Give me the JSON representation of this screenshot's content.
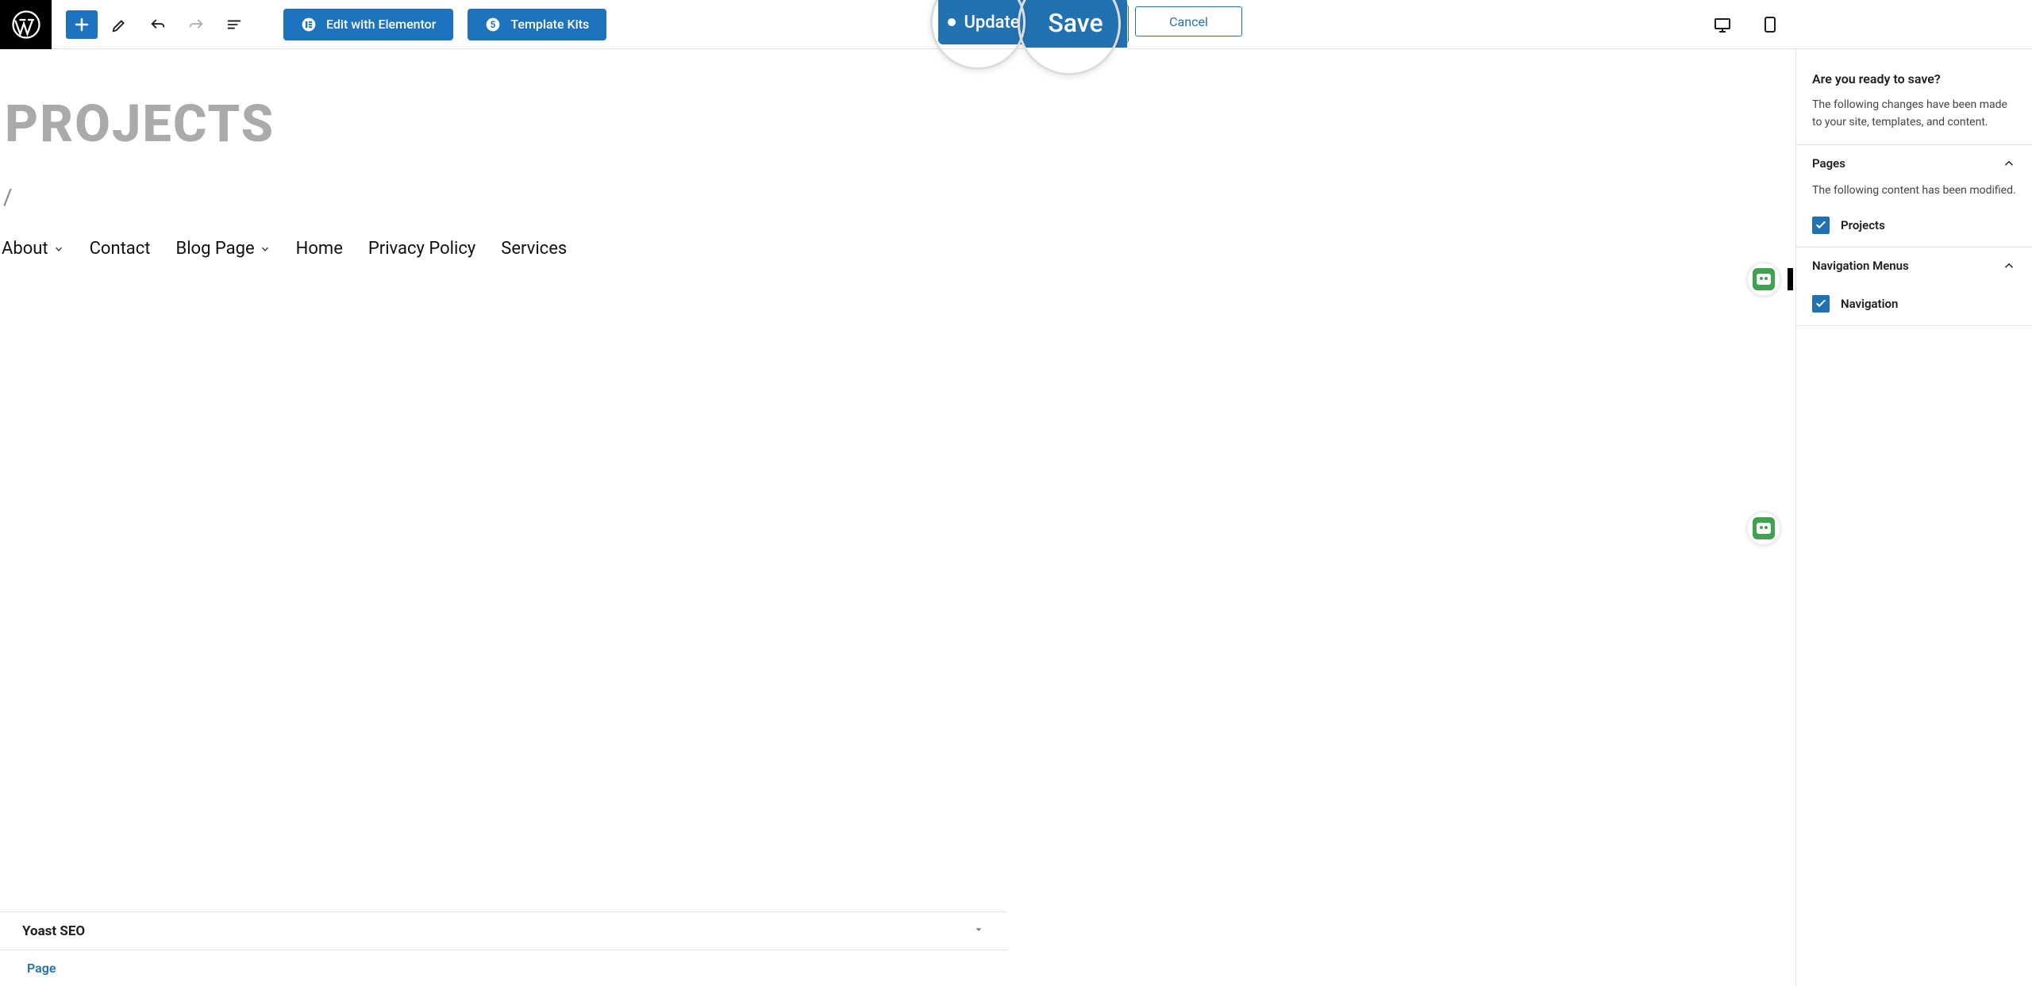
{
  "topbar": {
    "elementor_label": "Edit with Elementor",
    "template_kits_label": "Template Kits",
    "update_label": "Update",
    "save_label": "Save",
    "cancel_label": "Cancel"
  },
  "editor": {
    "page_title": "PROJECTS",
    "slash": "/",
    "nav": [
      {
        "label": "About",
        "dropdown": true
      },
      {
        "label": "Contact",
        "dropdown": false
      },
      {
        "label": "Blog Page",
        "dropdown": true
      },
      {
        "label": "Home",
        "dropdown": false
      },
      {
        "label": "Privacy Policy",
        "dropdown": false
      },
      {
        "label": "Services",
        "dropdown": false
      }
    ]
  },
  "sidebar": {
    "ready_heading": "Are you ready to save?",
    "ready_text": "The following changes have been made to your site, templates, and content.",
    "pages": {
      "title": "Pages",
      "desc": "The following content has been modified.",
      "items": [
        {
          "label": "Projects",
          "checked": true
        }
      ]
    },
    "nav_menus": {
      "title": "Navigation Menus",
      "items": [
        {
          "label": "Navigation",
          "checked": true
        }
      ]
    }
  },
  "footer": {
    "yoast_label": "Yoast SEO",
    "page_tab_label": "Page"
  }
}
